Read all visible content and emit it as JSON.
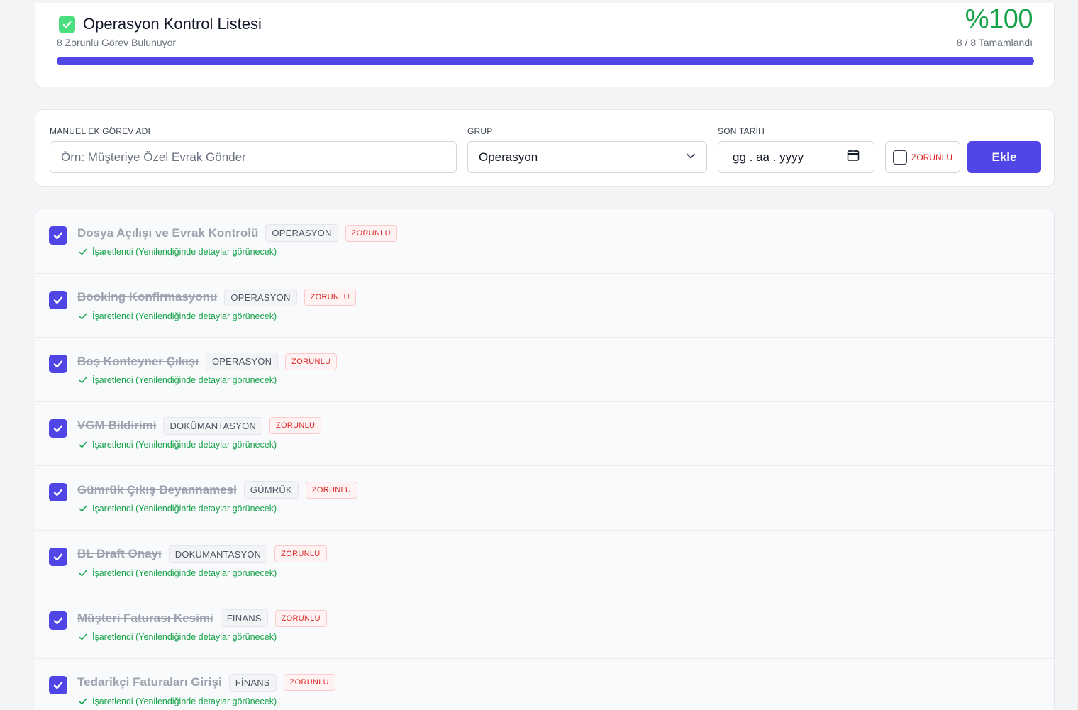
{
  "header": {
    "title": "Operasyon Kontrol Listesi",
    "subtitle": "8 Zorunlu Görev Bulunuyor",
    "percent_label": "%100",
    "completed_label": "8 / 8 Tamamlandı",
    "progress": 1.0
  },
  "form": {
    "task_label": "MANUEL EK GÖREV ADI",
    "task_placeholder": "Örn: Müşteriye Özel Evrak Gönder",
    "task_value": "",
    "group_label": "GRUP",
    "group_value": "Operasyon",
    "date_label": "SON TARİH",
    "date_placeholder": "gg . aa . yyyy",
    "mandatory_label": "ZORUNLU",
    "add_label": "Ekle"
  },
  "tasks": [
    {
      "name": "Dosya Açılışı ve Evrak Kontrolü",
      "group": "OPERASYON",
      "badge": "ZORUNLU",
      "status": "İşaretlendi (Yenilendiğinde detaylar görünecek)"
    },
    {
      "name": "Booking Konfirmasyonu",
      "group": "OPERASYON",
      "badge": "ZORUNLU",
      "status": "İşaretlendi (Yenilendiğinde detaylar görünecek)"
    },
    {
      "name": "Boş Konteyner Çıkışı",
      "group": "OPERASYON",
      "badge": "ZORUNLU",
      "status": "İşaretlendi (Yenilendiğinde detaylar görünecek)"
    },
    {
      "name": "VGM Bildirimi",
      "group": "DOKÜMANTASYON",
      "badge": "ZORUNLU",
      "status": "İşaretlendi (Yenilendiğinde detaylar görünecek)"
    },
    {
      "name": "Gümrük Çıkış Beyannamesi",
      "group": "GÜMRÜK",
      "badge": "ZORUNLU",
      "status": "İşaretlendi (Yenilendiğinde detaylar görünecek)"
    },
    {
      "name": "BL Draft Onayı",
      "group": "DOKÜMANTASYON",
      "badge": "ZORUNLU",
      "status": "İşaretlendi (Yenilendiğinde detaylar görünecek)"
    },
    {
      "name": "Müşteri Faturası Kesimi",
      "group": "FİNANS",
      "badge": "ZORUNLU",
      "status": "İşaretlendi (Yenilendiğinde detaylar görünecek)"
    },
    {
      "name": "Tedarikçi Faturaları Girişi",
      "group": "FİNANS",
      "badge": "ZORUNLU",
      "status": "İşaretlendi (Yenilendiğinde detaylar görünecek)"
    }
  ],
  "colors": {
    "accent": "#4f46e5",
    "success": "#16a34a",
    "danger": "#dc2626"
  }
}
